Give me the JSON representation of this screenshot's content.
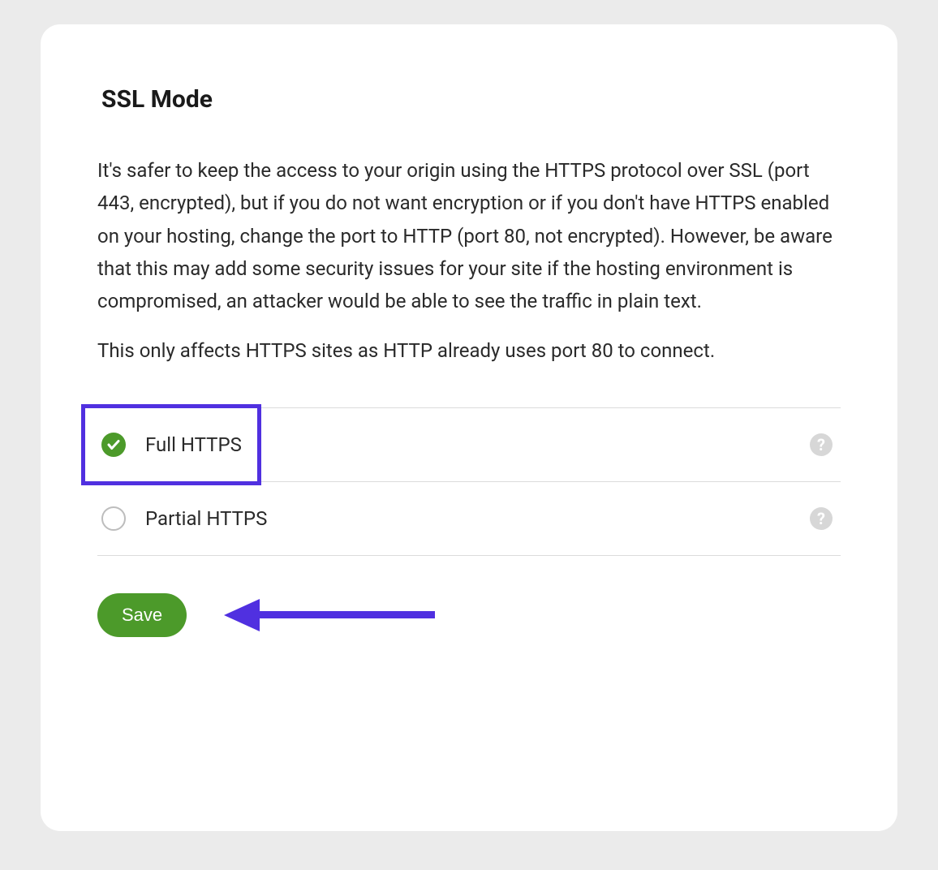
{
  "card": {
    "title": "SSL Mode",
    "description1": "It's safer to keep the access to your origin using the HTTPS protocol over SSL (port 443, encrypted), but if you do not want encryption or if you don't have HTTPS enabled on your hosting, change the port to HTTP (port 80, not encrypted). However, be aware that this may add some security issues for your site if the hosting environment is compromised, an attacker would be able to see the traffic in plain text.",
    "description2": "This only affects HTTPS sites as HTTP already uses port 80 to connect.",
    "options": [
      {
        "label": "Full HTTPS",
        "selected": true,
        "highlighted": true
      },
      {
        "label": "Partial HTTPS",
        "selected": false,
        "highlighted": false
      }
    ],
    "save_label": "Save"
  },
  "colors": {
    "accent_green": "#4c9a2a",
    "annotation_purple": "#5030e0"
  }
}
